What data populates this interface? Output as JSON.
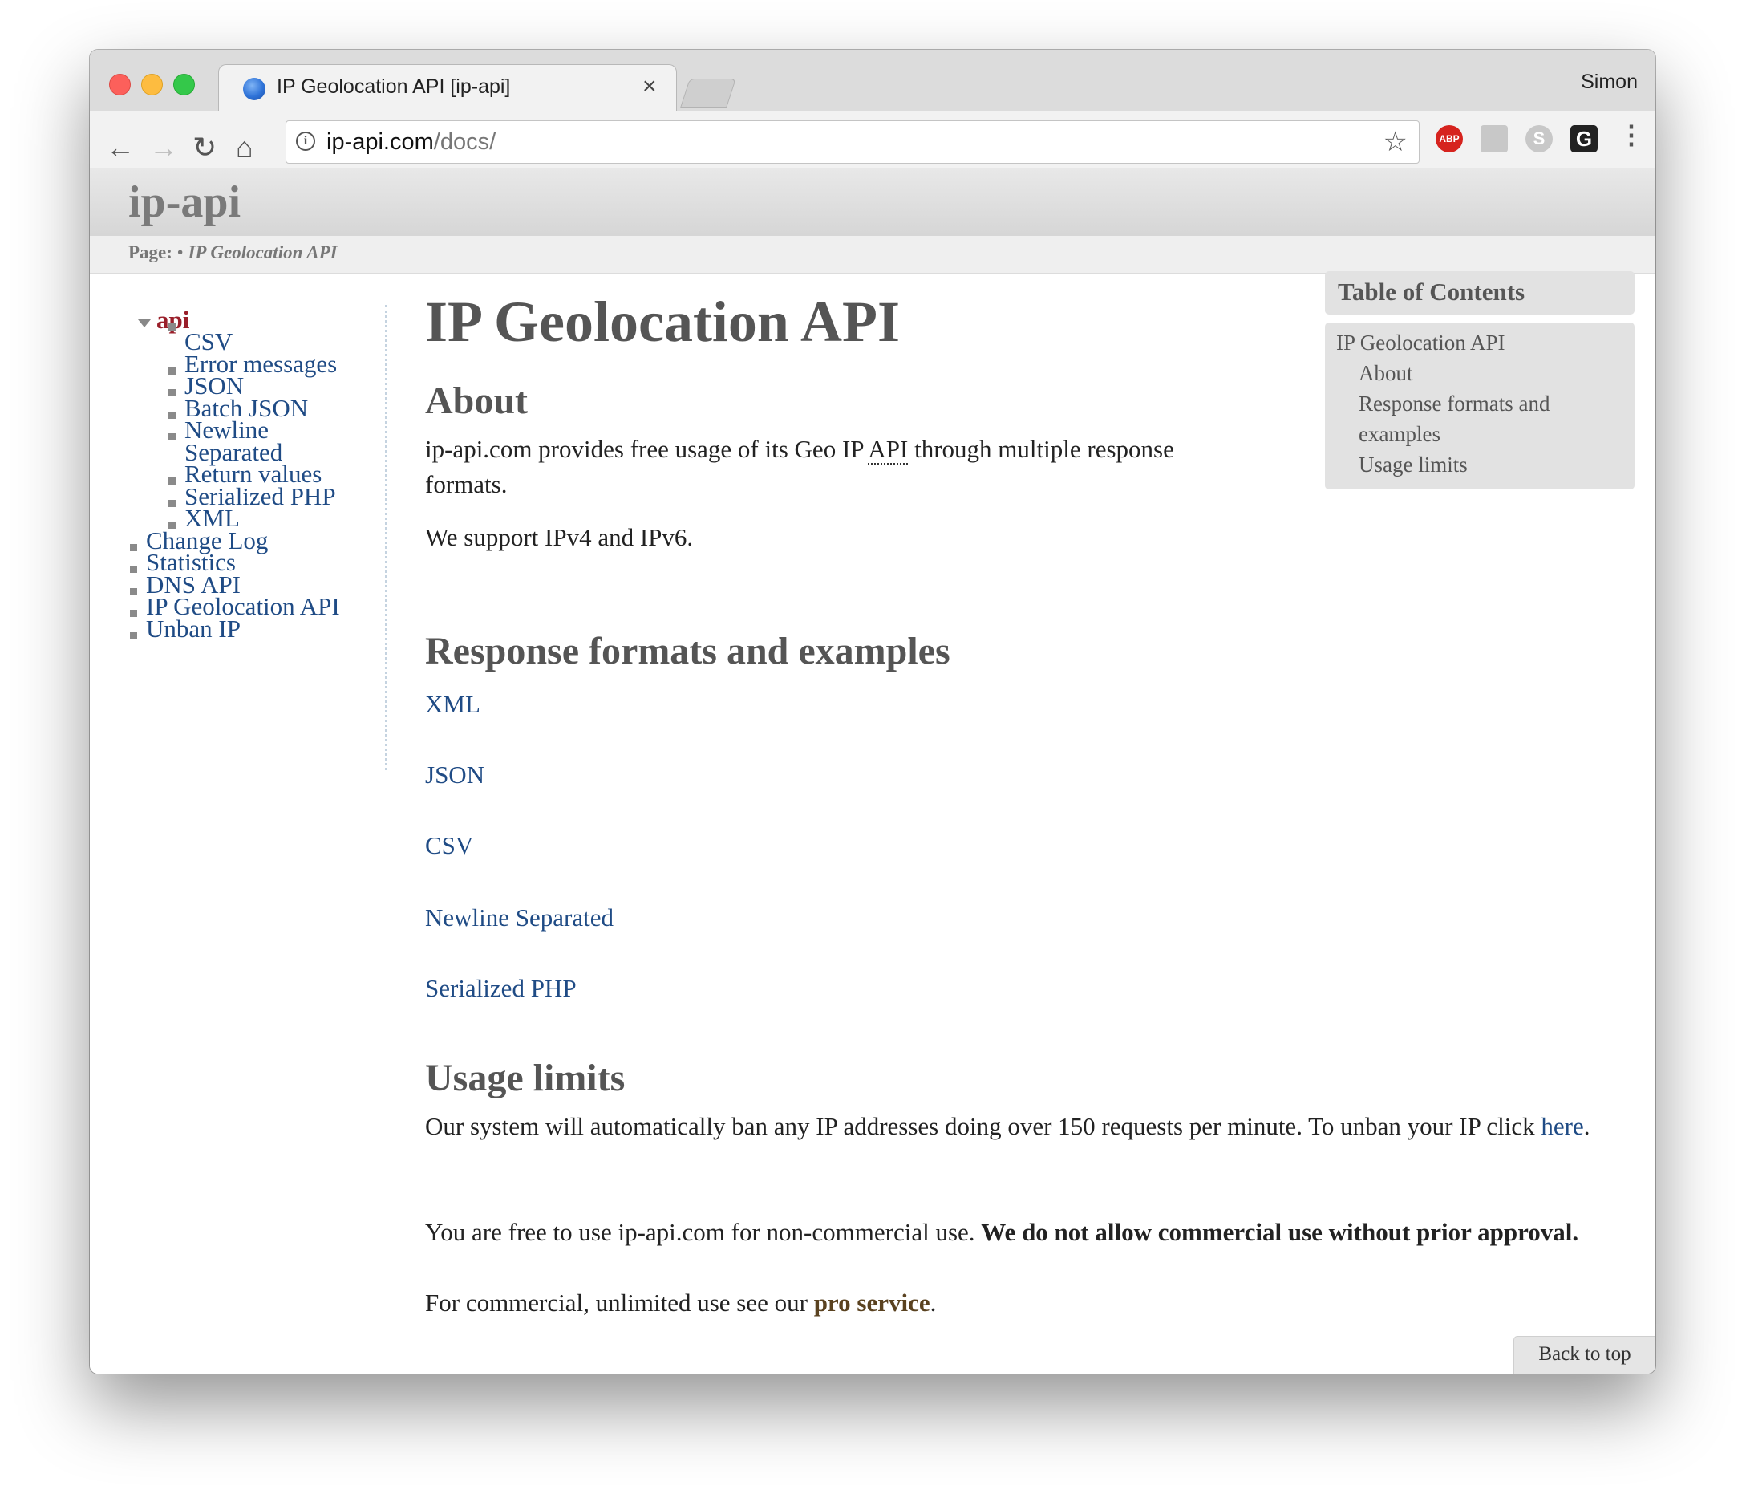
{
  "browser": {
    "tab_title": "IP Geolocation API [ip-api]",
    "tab_close": "×",
    "profile_name": "Simon",
    "url_host": "ip-api.com",
    "url_path": "/docs/",
    "extensions": {
      "abp_label": "ABP",
      "skype_label": "S",
      "g_label": "G"
    }
  },
  "site": {
    "logo": "ip-api",
    "breadcrumb_label": "Page:",
    "breadcrumb_sep": " • ",
    "breadcrumb_current": "IP Geolocation API"
  },
  "sidebar": {
    "section": "api",
    "subitems": [
      "CSV",
      "Error messages",
      "JSON",
      "Batch JSON",
      "Newline",
      "Separated",
      "Return values",
      "Serialized PHP",
      "XML"
    ],
    "items": [
      "Change Log",
      "Statistics",
      "DNS API",
      "IP Geolocation API",
      "Unban IP"
    ]
  },
  "main": {
    "title": "IP Geolocation API",
    "about_heading": "About",
    "about_p1_a": "ip-api.com provides free usage of its Geo IP ",
    "about_p1_abbr": "API",
    "about_p1_b": " through multiple response formats.",
    "about_p2": "We support IPv4 and IPv6.",
    "formats_heading": "Response formats and examples",
    "formats": [
      "XML",
      "JSON",
      "CSV",
      "Newline Separated",
      "Serialized PHP"
    ],
    "usage_heading": "Usage limits",
    "usage_p1": "Our system will automatically ban any IP addresses doing over 150 requests per minute. To unban your IP click ",
    "usage_p1_link": "here",
    "usage_p1_end": ".",
    "usage_p2_a": "You are free to use ip-api.com for non-commercial use. ",
    "usage_p2_b": "We do not allow commercial use without prior approval.",
    "usage_p3_a": "For commercial, unlimited use see our ",
    "usage_p3_link": "pro service",
    "usage_p3_end": "."
  },
  "toc": {
    "heading": "Table of Contents",
    "items": [
      "IP Geolocation API",
      "About",
      "Response formats and",
      "examples",
      "Usage limits"
    ]
  },
  "back_to_top": "Back to top"
}
